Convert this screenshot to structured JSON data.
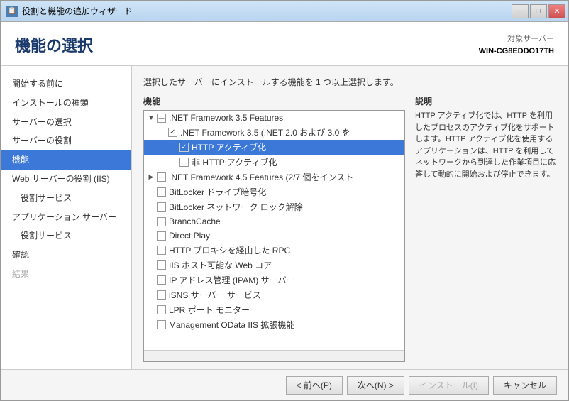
{
  "window": {
    "title": "役割と機能の追加ウィザード",
    "icon": "📋"
  },
  "titlebar": {
    "minimize": "─",
    "maximize": "□",
    "close": "✕"
  },
  "header": {
    "page_title": "機能の選択",
    "server_label": "対象サーバー",
    "server_name": "WIN-CG8EDDO17TH"
  },
  "instructions": "選択したサーバーにインストールする機能を 1 つ以上選択します。",
  "sidebar": {
    "items": [
      {
        "id": "before-start",
        "label": "開始する前に",
        "indent": 0,
        "active": false,
        "disabled": false
      },
      {
        "id": "install-type",
        "label": "インストールの種類",
        "indent": 0,
        "active": false,
        "disabled": false
      },
      {
        "id": "server-select",
        "label": "サーバーの選択",
        "indent": 0,
        "active": false,
        "disabled": false
      },
      {
        "id": "server-role",
        "label": "サーバーの役割",
        "indent": 0,
        "active": false,
        "disabled": false
      },
      {
        "id": "features",
        "label": "機能",
        "indent": 0,
        "active": true,
        "disabled": false
      },
      {
        "id": "web-server",
        "label": "Web サーバーの役割 (IIS)",
        "indent": 0,
        "active": false,
        "disabled": false
      },
      {
        "id": "role-services",
        "label": "役割サービス",
        "indent": 1,
        "active": false,
        "disabled": false
      },
      {
        "id": "app-server",
        "label": "アプリケーション サーバー",
        "indent": 0,
        "active": false,
        "disabled": false
      },
      {
        "id": "role-services2",
        "label": "役割サービス",
        "indent": 1,
        "active": false,
        "disabled": false
      },
      {
        "id": "confirm",
        "label": "確認",
        "indent": 0,
        "active": false,
        "disabled": false
      },
      {
        "id": "results",
        "label": "結果",
        "indent": 0,
        "active": false,
        "disabled": true
      }
    ]
  },
  "features_label": "機能",
  "description_label": "説明",
  "description_text": "HTTP アクティブ化では、HTTP を利用したプロセスのアクティブ化をサポートします。HTTP アクティブ化を使用するアプリケーションは、HTTP を利用してネットワークから到達した作業項目に応答して動的に開始および停止できます。",
  "features": [
    {
      "id": "net35-features",
      "label": ".NET Framework 3.5 Features",
      "indent": 1,
      "expand": "expanded",
      "checked": "partial",
      "selected": false
    },
    {
      "id": "net35",
      "label": ".NET Framework 3.5 (.NET 2.0 および 3.0 を",
      "indent": 2,
      "expand": "empty",
      "checked": "checked",
      "selected": false
    },
    {
      "id": "http-activation",
      "label": "HTTP アクティブ化",
      "indent": 3,
      "expand": "empty",
      "checked": "checked",
      "selected": true
    },
    {
      "id": "non-http-activation",
      "label": "非 HTTP アクティブ化",
      "indent": 3,
      "expand": "empty",
      "checked": "unchecked",
      "selected": false
    },
    {
      "id": "net45-features",
      "label": ".NET Framework 4.5 Features (2/7 個をインスト",
      "indent": 1,
      "expand": "collapsed",
      "checked": "partial",
      "selected": false
    },
    {
      "id": "bitlocker-drive",
      "label": "BitLocker ドライブ暗号化",
      "indent": 1,
      "expand": "empty",
      "checked": "unchecked",
      "selected": false
    },
    {
      "id": "bitlocker-network",
      "label": "BitLocker ネットワーク ロック解除",
      "indent": 1,
      "expand": "empty",
      "checked": "unchecked",
      "selected": false
    },
    {
      "id": "branchcache",
      "label": "BranchCache",
      "indent": 1,
      "expand": "empty",
      "checked": "unchecked",
      "selected": false
    },
    {
      "id": "direct-play",
      "label": "Direct Play",
      "indent": 1,
      "expand": "empty",
      "checked": "unchecked",
      "selected": false
    },
    {
      "id": "http-rpc",
      "label": "HTTP プロキシを経由した RPC",
      "indent": 1,
      "expand": "empty",
      "checked": "unchecked",
      "selected": false
    },
    {
      "id": "iis-web-core",
      "label": "IIS ホスト可能な Web コア",
      "indent": 1,
      "expand": "empty",
      "checked": "unchecked",
      "selected": false
    },
    {
      "id": "ip-admin",
      "label": "IP アドレス管理 (IPAM) サーバー",
      "indent": 1,
      "expand": "empty",
      "checked": "unchecked",
      "selected": false
    },
    {
      "id": "isns",
      "label": "iSNS サーバー サービス",
      "indent": 1,
      "expand": "empty",
      "checked": "unchecked",
      "selected": false
    },
    {
      "id": "lpr",
      "label": "LPR ポート モニター",
      "indent": 1,
      "expand": "empty",
      "checked": "unchecked",
      "selected": false
    },
    {
      "id": "management",
      "label": "Management OData IIS 拡張機能",
      "indent": 1,
      "expand": "empty",
      "checked": "unchecked",
      "selected": false
    }
  ],
  "footer": {
    "prev_label": "< 前へ(P)",
    "next_label": "次へ(N) >",
    "install_label": "インストール(I)",
    "cancel_label": "キャンセル"
  }
}
